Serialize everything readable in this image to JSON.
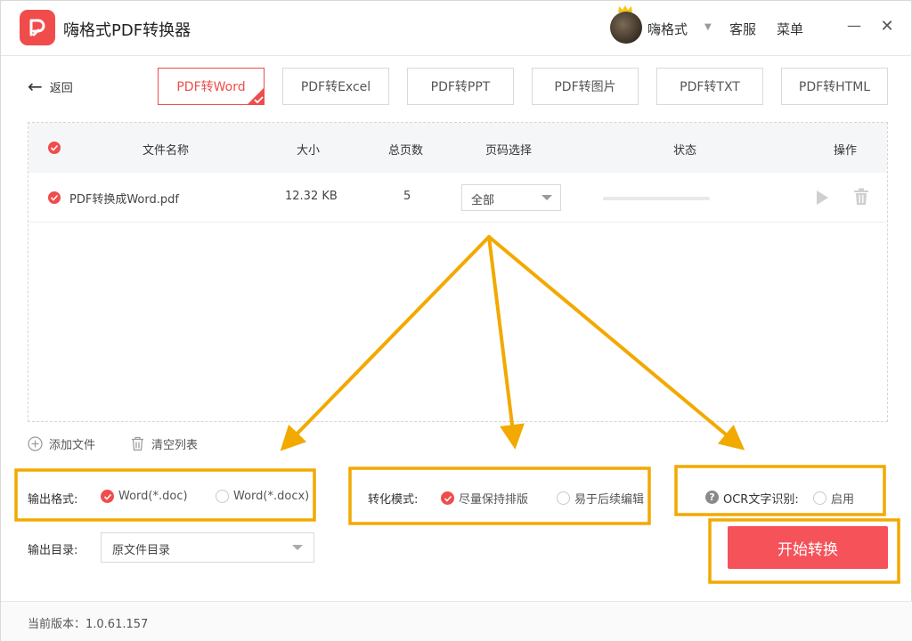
{
  "app": {
    "title": "嗨格式PDF转换器"
  },
  "titlebar": {
    "user_name": "嗨格式",
    "service": "客服",
    "menu": "菜单",
    "minimize": "—",
    "close": "✕"
  },
  "nav": {
    "back_label": "返回",
    "tabs": [
      {
        "label": "PDF转Word",
        "active": true
      },
      {
        "label": "PDF转Excel",
        "active": false
      },
      {
        "label": "PDF转PPT",
        "active": false
      },
      {
        "label": "PDF转图片",
        "active": false
      },
      {
        "label": "PDF转TXT",
        "active": false
      },
      {
        "label": "PDF转HTML",
        "active": false
      }
    ]
  },
  "table": {
    "headers": {
      "name": "文件名称",
      "size": "大小",
      "pages": "总页数",
      "page_select": "页码选择",
      "status": "状态",
      "action": "操作"
    },
    "rows": [
      {
        "name": "PDF转换成Word.pdf",
        "size": "12.32 KB",
        "pages": "5",
        "page_select": "全部",
        "progress": 0
      }
    ]
  },
  "list_actions": {
    "add": "添加文件",
    "clear": "清空列表"
  },
  "options": {
    "format_label": "输出格式:",
    "format_doc": "Word(*.doc)",
    "format_docx": "Word(*.docx)",
    "mode_label": "转化模式:",
    "mode_layout": "尽量保持排版",
    "mode_edit": "易于后续编辑",
    "ocr_label": "OCR文字识别:",
    "ocr_enable": "启用",
    "dir_label": "输出目录:",
    "dir_value": "原文件目录"
  },
  "start_button": "开始转换",
  "footer": {
    "version": "当前版本：1.0.61.157"
  },
  "colors": {
    "accent": "#f04c4c",
    "annotation": "#f2a900"
  }
}
